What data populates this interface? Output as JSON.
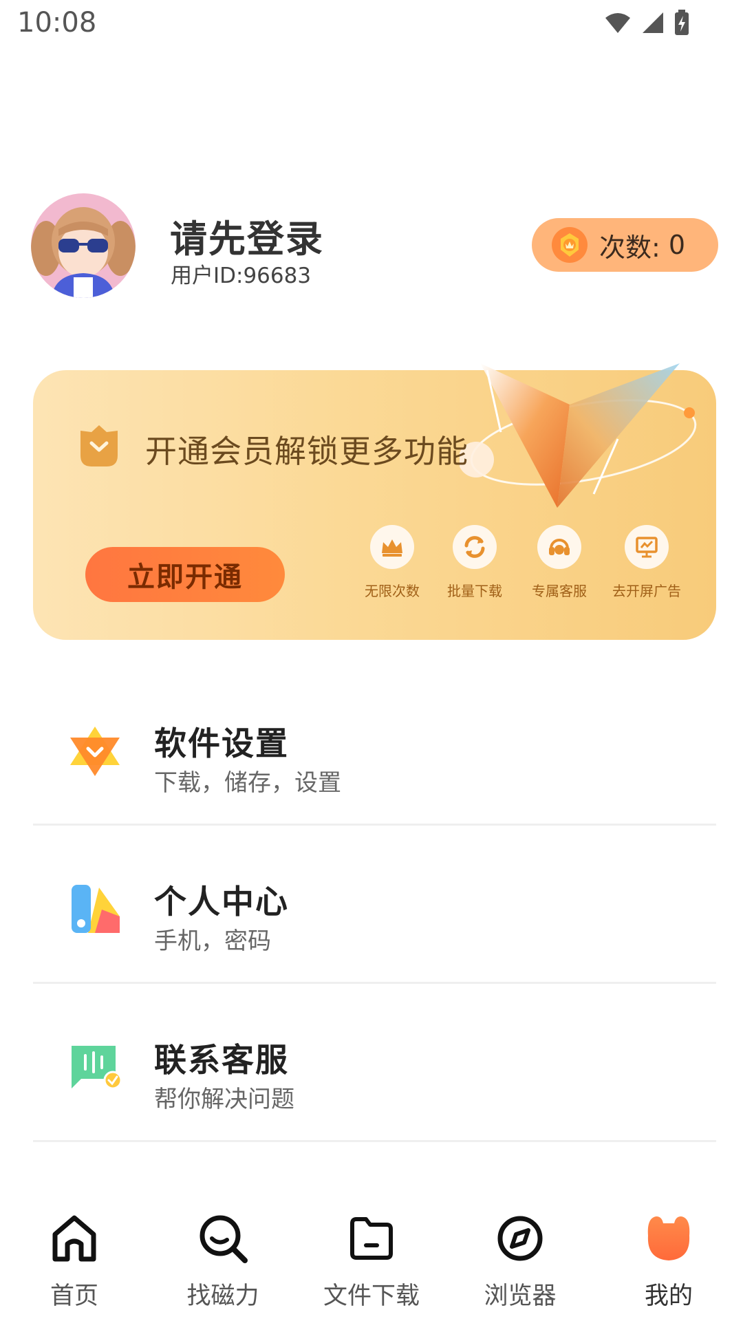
{
  "status_bar": {
    "time": "10:08"
  },
  "profile": {
    "name": "请先登录",
    "user_id": "用户ID:96683",
    "count_label": "次数:",
    "count_value": "0"
  },
  "vip": {
    "title": "开通会员解锁更多功能",
    "button_label": "立即开通",
    "perks": [
      {
        "label": "无限次数",
        "icon": "crown-icon"
      },
      {
        "label": "批量下载",
        "icon": "refresh-icon"
      },
      {
        "label": "专属客服",
        "icon": "headset-icon"
      },
      {
        "label": "去开屏广告",
        "icon": "presentation-icon"
      }
    ]
  },
  "menu": [
    {
      "title": "软件设置",
      "subtitle": "下载，储存，设置",
      "icon": "settings-star-icon"
    },
    {
      "title": "个人中心",
      "subtitle": "手机，密码",
      "icon": "personal-center-icon"
    },
    {
      "title": "联系客服",
      "subtitle": "帮你解决问题",
      "icon": "chat-support-icon"
    }
  ],
  "bottom_nav": [
    {
      "label": "首页",
      "icon": "home-icon"
    },
    {
      "label": "找磁力",
      "icon": "search-icon"
    },
    {
      "label": "文件下载",
      "icon": "folder-icon"
    },
    {
      "label": "浏览器",
      "icon": "compass-icon"
    },
    {
      "label": "我的",
      "icon": "mine-icon",
      "active": true
    }
  ],
  "colors": {
    "accent": "#ff7a3c",
    "badge": "#ffb57a",
    "card_start": "#fde4b4",
    "card_end": "#f8cb7a"
  }
}
